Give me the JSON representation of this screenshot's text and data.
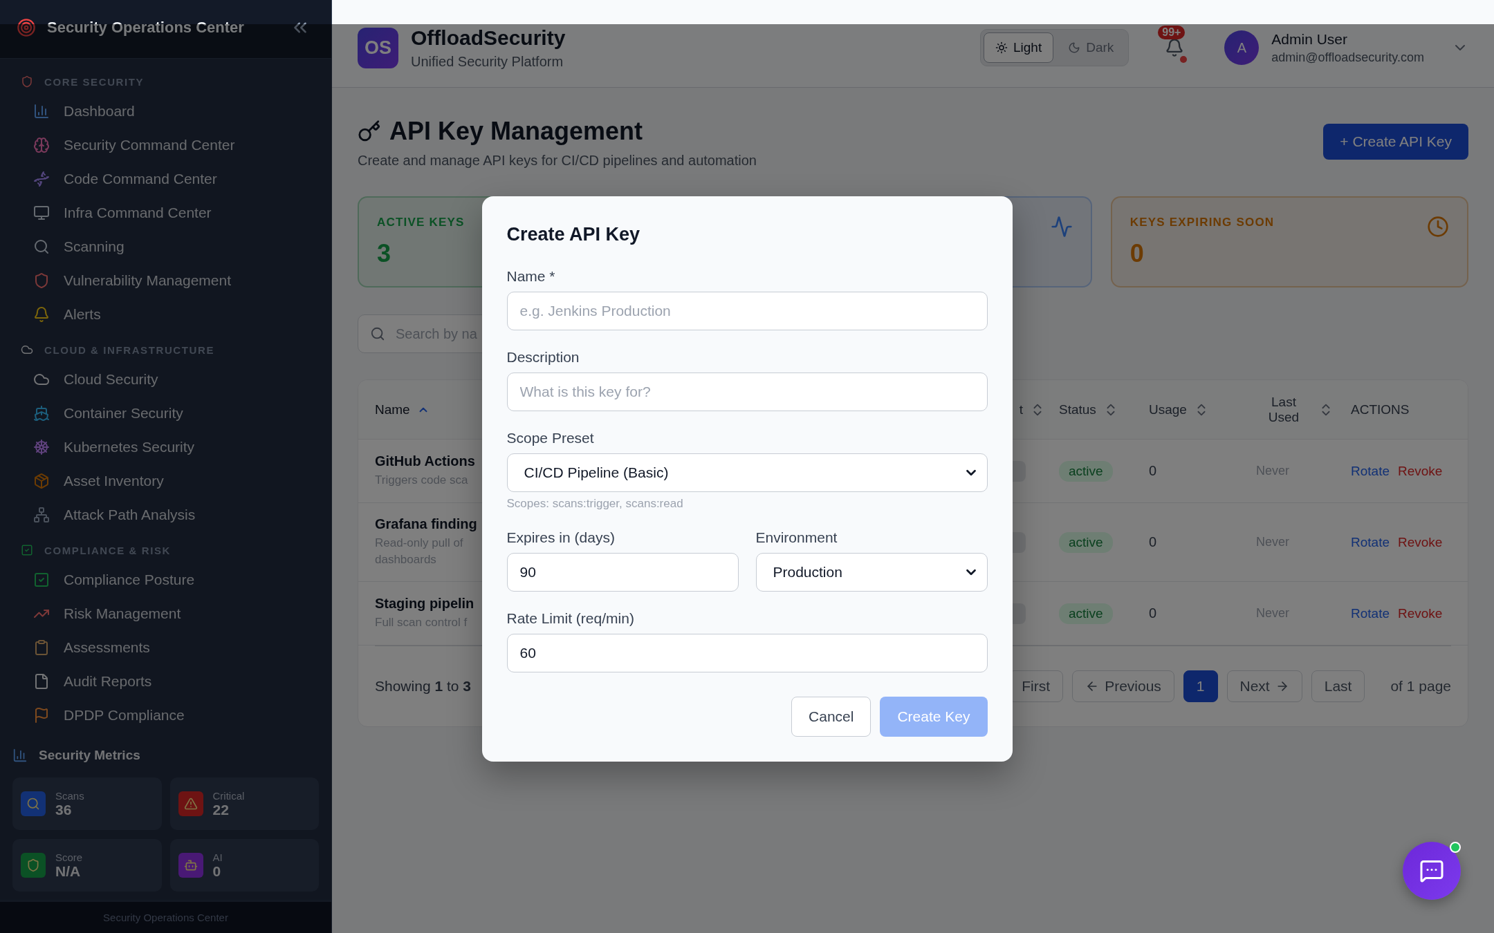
{
  "sidebar": {
    "title": "Security Operations Center",
    "sections": [
      {
        "heading": "CORE SECURITY",
        "items": [
          {
            "label": "Dashboard"
          },
          {
            "label": "Security Command Center"
          },
          {
            "label": "Code Command Center"
          },
          {
            "label": "Infra Command Center"
          },
          {
            "label": "Scanning"
          },
          {
            "label": "Vulnerability Management"
          },
          {
            "label": "Alerts"
          }
        ]
      },
      {
        "heading": "CLOUD & INFRASTRUCTURE",
        "items": [
          {
            "label": "Cloud Security"
          },
          {
            "label": "Container Security"
          },
          {
            "label": "Kubernetes Security"
          },
          {
            "label": "Asset Inventory"
          },
          {
            "label": "Attack Path Analysis"
          }
        ]
      },
      {
        "heading": "COMPLIANCE & RISK",
        "items": [
          {
            "label": "Compliance Posture"
          },
          {
            "label": "Risk Management"
          },
          {
            "label": "Assessments"
          },
          {
            "label": "Audit Reports"
          },
          {
            "label": "DPDP Compliance"
          }
        ]
      }
    ],
    "metrics_title": "Security Metrics",
    "metrics": [
      {
        "kind": "scans",
        "label": "Scans",
        "value": "36"
      },
      {
        "kind": "critical",
        "label": "Critical",
        "value": "22"
      },
      {
        "kind": "score",
        "label": "Score",
        "value": "N/A"
      },
      {
        "kind": "ai",
        "label": "AI",
        "value": "0"
      }
    ],
    "footer": "Security Operations Center"
  },
  "header": {
    "logo": "OS",
    "brand": "OffloadSecurity",
    "tagline": "Unified Security Platform",
    "theme_toggle": [
      {
        "kind": "light",
        "label": "Light",
        "selected": true
      },
      {
        "kind": "dark",
        "label": "Dark",
        "selected": false
      }
    ],
    "notifications_badge": "99+",
    "user": {
      "avatar": "A",
      "name": "Admin User",
      "email": "admin@offloadsecurity.com"
    }
  },
  "page": {
    "title": "API Key Management",
    "subtitle": "Create and manage API keys for CI/CD pipelines and automation",
    "create_button": "+ Create API Key"
  },
  "stats": [
    {
      "kind": "active",
      "label": "ACTIVE KEYS",
      "value": "3"
    },
    {
      "kind": "activity"
    },
    {
      "kind": "expiring",
      "label": "KEYS EXPIRING SOON",
      "value": "0"
    }
  ],
  "search": {
    "placeholder": "Search by na"
  },
  "table": {
    "columns": [
      {
        "label": "Name",
        "sortable": true,
        "sorted": true
      },
      {
        "label": "t",
        "sortable": true,
        "sorted": false
      },
      {
        "label": "Status",
        "sortable": true,
        "sorted": false
      },
      {
        "label": "Usage",
        "sortable": true,
        "sorted": false
      },
      {
        "label": "Last Used",
        "sortable": true,
        "sorted": false
      },
      {
        "label": "ACTIONS",
        "sortable": false,
        "sorted": false
      }
    ],
    "rows": [
      {
        "name": "GitHub Actions",
        "description": [
          "Triggers code sca"
        ],
        "status": "active",
        "usage": "0",
        "last_used": "Never",
        "actions": [
          "Rotate",
          "Revoke"
        ]
      },
      {
        "name": "Grafana finding",
        "description": [
          "Read-only pull of",
          "dashboards"
        ],
        "status": "active",
        "usage": "0",
        "last_used": "Never",
        "actions": [
          "Rotate",
          "Revoke"
        ]
      },
      {
        "name": "Staging pipelin",
        "description": [
          "Full scan control f"
        ],
        "status": "active",
        "usage": "0",
        "last_used": "Never",
        "actions": [
          "Rotate",
          "Revoke"
        ]
      }
    ],
    "footer": {
      "showing": "Showing **1** to **3**",
      "first": "First",
      "previous": "Previous",
      "pages": [
        {
          "label": "1",
          "selected": true
        }
      ],
      "next": "Next",
      "last": "Last",
      "page_count": "of 1 page"
    }
  },
  "dialog": {
    "title": "Create API Key",
    "rows": [
      [
        {
          "kind": "text",
          "label": "Name *",
          "placeholder": "e.g. Jenkins Production"
        }
      ],
      [
        {
          "kind": "text",
          "label": "Description",
          "placeholder": "What is this key for?"
        }
      ],
      [
        {
          "kind": "select",
          "label": "Scope Preset",
          "value": "CI/CD Pipeline (Basic)",
          "hint": "Scopes: scans:trigger, scans:read"
        }
      ],
      [
        {
          "kind": "text",
          "label": "Expires in (days)",
          "value": "90"
        },
        {
          "kind": "select",
          "label": "Environment",
          "value": "Production"
        }
      ],
      [
        {
          "kind": "text",
          "label": "Rate Limit (req/min)",
          "value": "60"
        }
      ]
    ],
    "buttons": [
      {
        "kind": "secondary",
        "label": "Cancel",
        "disabled": false
      },
      {
        "kind": "primary",
        "label": "Create Key",
        "disabled": true
      }
    ]
  }
}
